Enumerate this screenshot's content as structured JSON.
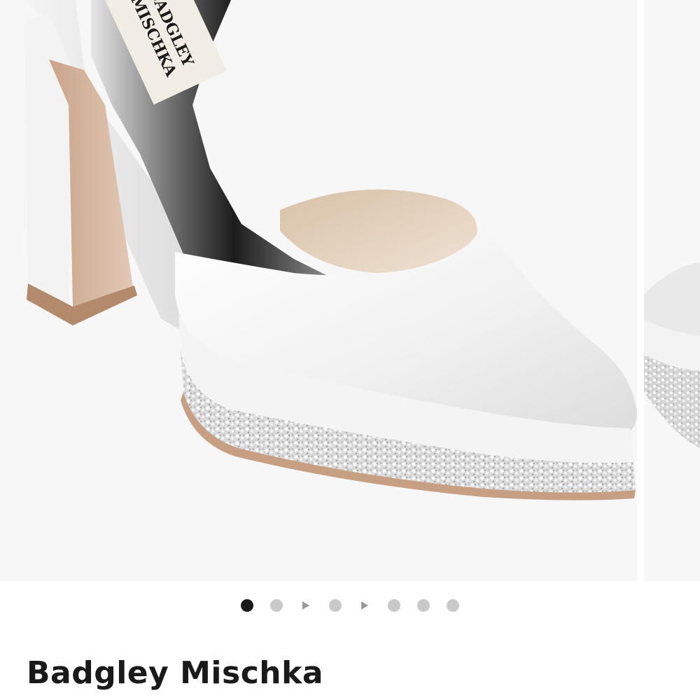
{
  "product": {
    "brand": "Badgley Mischka",
    "image": {
      "insole_label_line1": "BADGLEY",
      "insole_label_line2": "MISCHKA"
    }
  },
  "carousel": {
    "active_index": 0,
    "indicators": [
      {
        "type": "image",
        "active": true
      },
      {
        "type": "image",
        "active": false
      },
      {
        "type": "video",
        "active": false,
        "icon": "play-icon"
      },
      {
        "type": "image",
        "active": false
      },
      {
        "type": "video",
        "active": false,
        "icon": "play-icon"
      },
      {
        "type": "image",
        "active": false
      },
      {
        "type": "image",
        "active": false
      },
      {
        "type": "image",
        "active": false
      }
    ]
  },
  "colors": {
    "background": "#ffffff",
    "photo_background": "#f7f7f7",
    "dot_active": "#1a1a1a",
    "dot_inactive": "#c9c9c9",
    "text": "#1a1a1a"
  }
}
